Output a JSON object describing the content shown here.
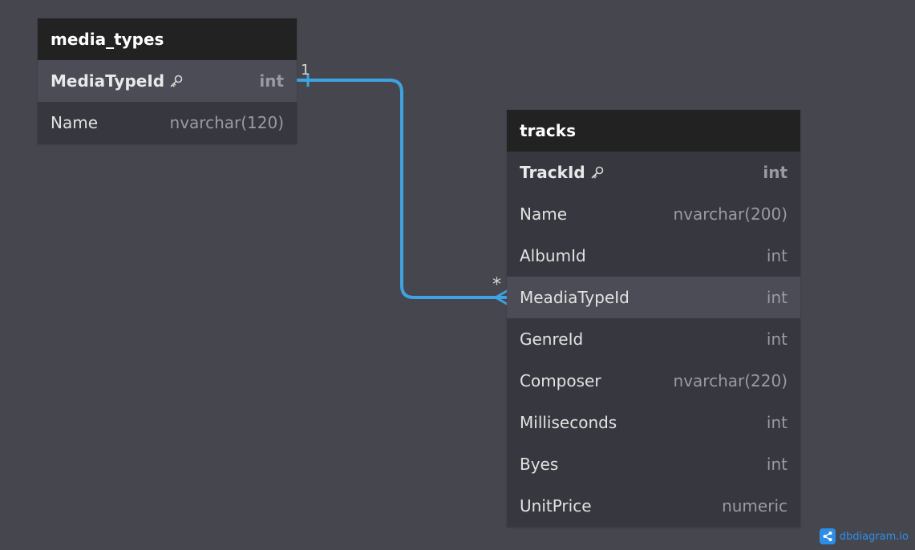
{
  "tables": {
    "media_types": {
      "name": "media_types",
      "fields": [
        {
          "name": "MediaTypeId",
          "type": "int"
        },
        {
          "name": "Name",
          "type": "nvarchar(120)"
        }
      ]
    },
    "tracks": {
      "name": "tracks",
      "fields": [
        {
          "name": "TrackId",
          "type": "int"
        },
        {
          "name": "Name",
          "type": "nvarchar(200)"
        },
        {
          "name": "AlbumId",
          "type": "int"
        },
        {
          "name": "MeadiaTypeId",
          "type": "int"
        },
        {
          "name": "GenreId",
          "type": "int"
        },
        {
          "name": "Composer",
          "type": "nvarchar(220)"
        },
        {
          "name": "Milliseconds",
          "type": "int"
        },
        {
          "name": "Byes",
          "type": "int"
        },
        {
          "name": "UnitPrice",
          "type": "numeric"
        }
      ]
    }
  },
  "relation": {
    "one_label": "1",
    "many_label": "*",
    "color": "#3ea3e0"
  },
  "icons": {
    "primary_key": "key-icon",
    "logo": "share-icon"
  },
  "watermark": {
    "text": "dbdiagram.io"
  }
}
